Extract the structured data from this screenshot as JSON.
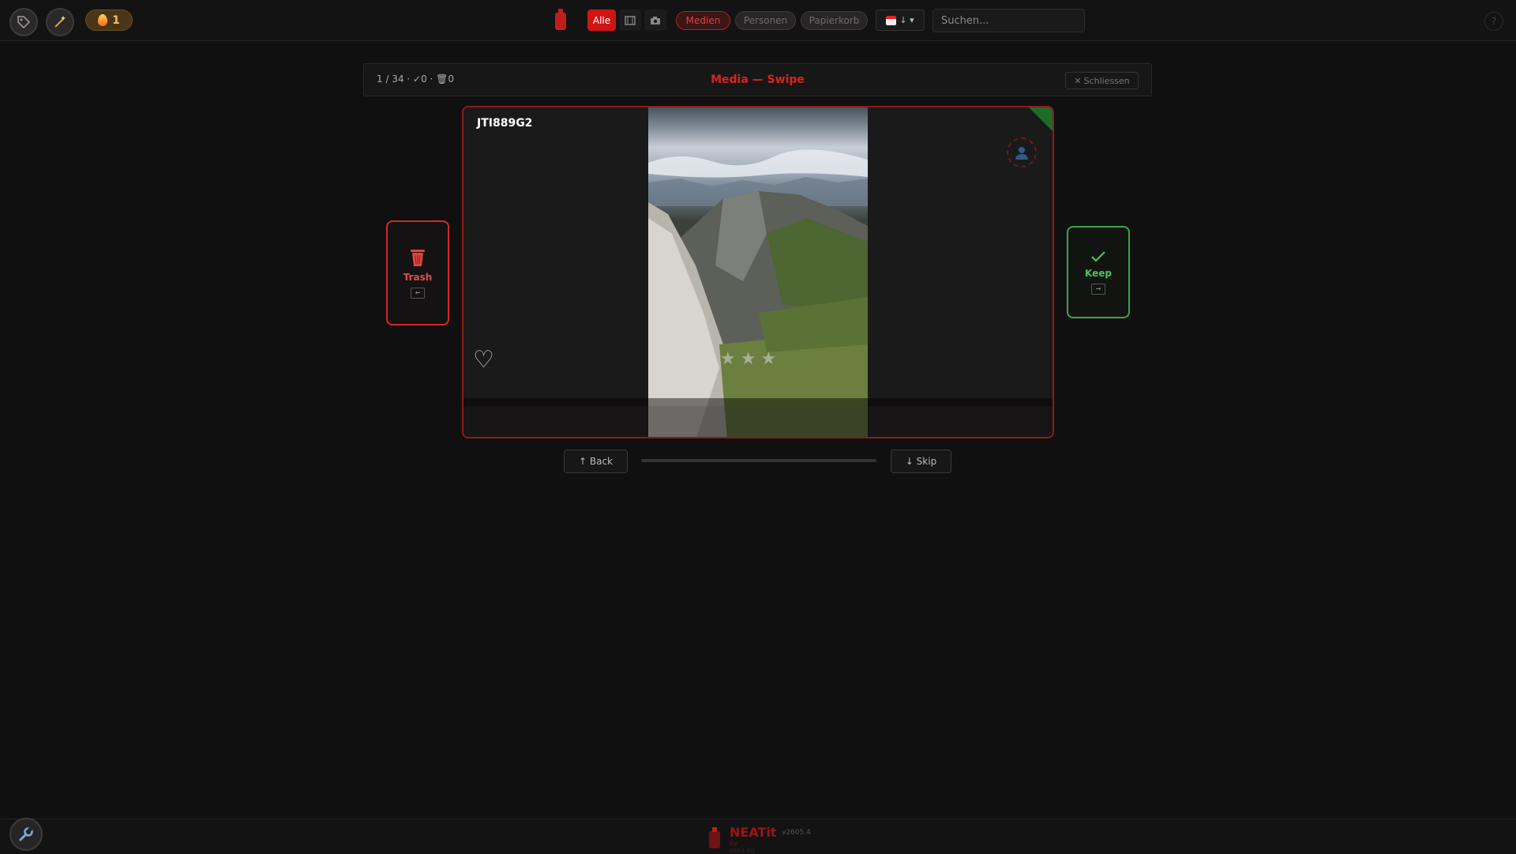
{
  "topbar": {
    "streak_count": "1",
    "filters": {
      "all_label": "Alle"
    },
    "sections": {
      "media": "Medien",
      "persons": "Personen",
      "trash": "Papierkorb"
    },
    "sort_arrow": "↓ ▾",
    "search_placeholder": "Suchen...",
    "help_label": "?"
  },
  "swipe": {
    "counter": "1 / 34 · ✓0 · 🗑0",
    "title": "Media — Swipe",
    "close_label": "Schliessen",
    "card": {
      "id": "JTI889G2",
      "rating": 3
    },
    "trash_label": "Trash",
    "keep_label": "Keep",
    "trash_key": "←",
    "keep_key": "→",
    "back_label": "↑ Back",
    "skip_label": "↓ Skip",
    "progress": 0
  },
  "footer": {
    "brand": "NEATit",
    "version": "v2605.4",
    "by": "by coxu.eu"
  },
  "colors": {
    "accent": "#d11414",
    "keep": "#3aa547",
    "trash": "#d42828"
  },
  "icons": [
    "tag-icon",
    "magic-wand-icon",
    "flame-icon",
    "bottle-logo-icon",
    "film-icon",
    "camera-icon",
    "calendar-icon",
    "person-icon",
    "heart-icon",
    "star-icon",
    "trash-icon",
    "check-icon",
    "wrench-icon"
  ]
}
